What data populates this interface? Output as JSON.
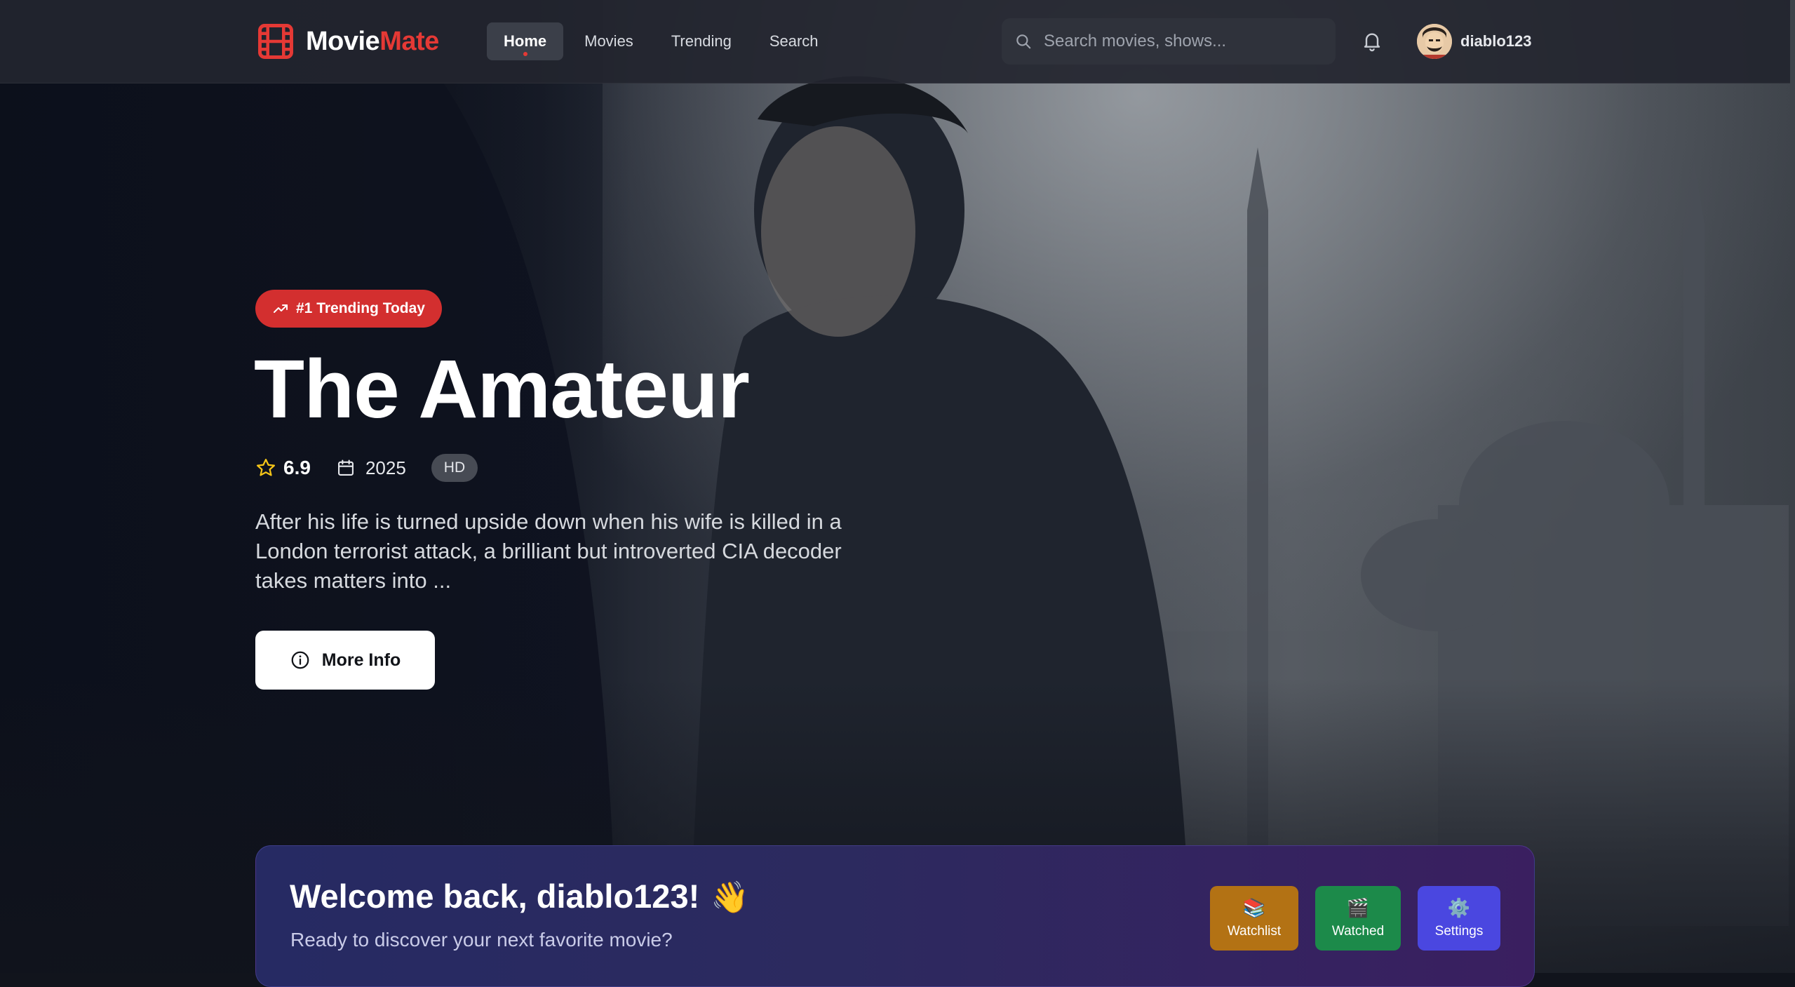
{
  "brand": {
    "name_part1": "Movie",
    "name_part2": "Mate",
    "accent": "#e53935",
    "icon": "film-icon"
  },
  "nav": {
    "items": [
      {
        "label": "Home",
        "active": true
      },
      {
        "label": "Movies",
        "active": false
      },
      {
        "label": "Trending",
        "active": false
      },
      {
        "label": "Search",
        "active": false
      }
    ]
  },
  "search": {
    "placeholder": "Search movies, shows...",
    "value": "",
    "icon": "search-icon"
  },
  "notifications": {
    "icon": "bell-icon"
  },
  "user": {
    "name": "diablo123",
    "avatar": "user-avatar"
  },
  "hero": {
    "badge": "#1 Trending Today",
    "badge_icon": "trending-up-icon",
    "badge_color": "#d32f2f",
    "title": "The Amateur",
    "rating": "6.9",
    "year": "2025",
    "quality": "HD",
    "description": "After his life is turned upside down when his wife is killed in a London terrorist attack, a brilliant but introverted CIA decoder takes matters into ...",
    "more_info_label": "More Info"
  },
  "welcome": {
    "title": "Welcome back, diablo123!",
    "wave": "👋",
    "subtitle": "Ready to discover your next favorite movie?",
    "tiles": [
      {
        "label": "Watchlist",
        "icon": "📚",
        "color": "#b37214"
      },
      {
        "label": "Watched",
        "icon": "🎬",
        "color": "#1c8a4a"
      },
      {
        "label": "Settings",
        "icon": "⚙️",
        "color": "#4a47e0"
      }
    ]
  }
}
